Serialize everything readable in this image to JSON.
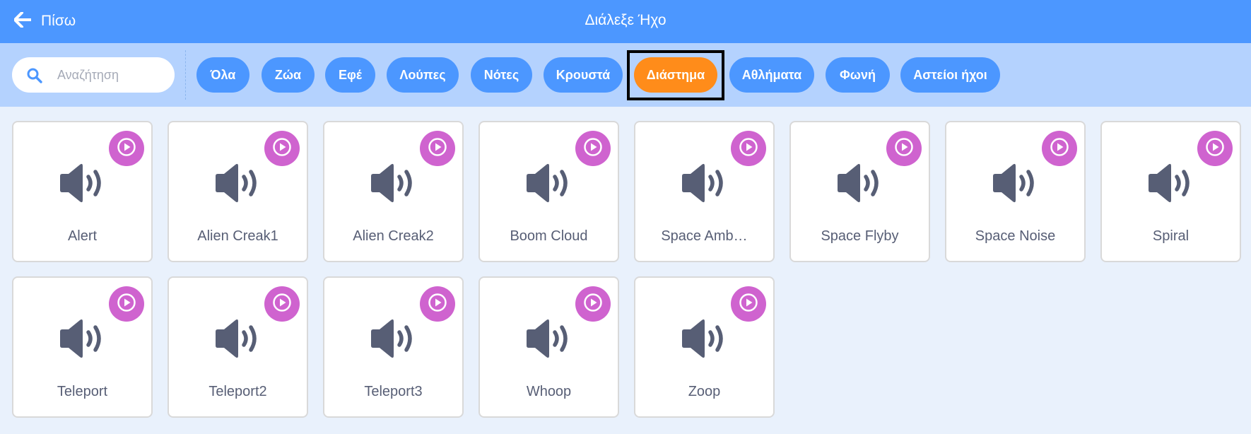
{
  "header": {
    "back_label": "Πίσω",
    "title": "Διάλεξε Ήχο",
    "back_icon": "arrow-left-icon"
  },
  "search": {
    "placeholder": "Αναζήτηση",
    "value": "",
    "icon": "search-icon"
  },
  "tags": [
    {
      "label": "Όλα",
      "active": false
    },
    {
      "label": "Ζώα",
      "active": false
    },
    {
      "label": "Εφέ",
      "active": false
    },
    {
      "label": "Λούπες",
      "active": false
    },
    {
      "label": "Νότες",
      "active": false
    },
    {
      "label": "Κρουστά",
      "active": false
    },
    {
      "label": "Διάστημα",
      "active": true
    },
    {
      "label": "Αθλήματα",
      "active": false
    },
    {
      "label": "Φωνή",
      "active": false
    },
    {
      "label": "Αστείοι ήχοι",
      "active": false
    }
  ],
  "sounds": [
    {
      "name": "Alert"
    },
    {
      "name": "Alien Creak1"
    },
    {
      "name": "Alien Creak2"
    },
    {
      "name": "Boom Cloud"
    },
    {
      "name": "Space Amb…"
    },
    {
      "name": "Space Flyby"
    },
    {
      "name": "Space Noise"
    },
    {
      "name": "Spiral"
    },
    {
      "name": "Teleport"
    },
    {
      "name": "Teleport2"
    },
    {
      "name": "Teleport3"
    },
    {
      "name": "Whoop"
    },
    {
      "name": "Zoop"
    }
  ],
  "colors": {
    "header_bg": "#4c97ff",
    "filter_bg": "#b4d2fe",
    "tag_bg": "#4c97ff",
    "tag_active_bg": "#ff8c1a",
    "play_button": "#cf63cf",
    "speaker_icon": "#575e75",
    "page_bg": "#e9f1fc"
  }
}
